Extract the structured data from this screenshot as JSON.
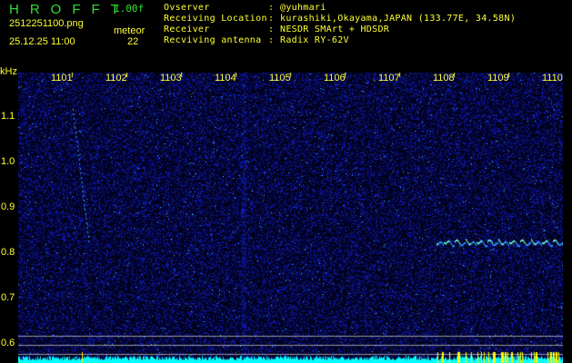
{
  "header": {
    "app_name": "HROFFT",
    "version": "1.00f",
    "filename": "2512251100.png",
    "datetime": "25.12.25 11:00",
    "meteor_label": "meteor",
    "meteor_count": "22"
  },
  "info": [
    {
      "label": "Ovserver",
      "value": "@yuhmari"
    },
    {
      "label": "Receiving Location",
      "value": "kurashiki,Okayama,JAPAN (133.77E, 34.58N)"
    },
    {
      "label": "Receiver",
      "value": "NESDR SMArt + HDSDR"
    },
    {
      "label": "Recviving antenna",
      "value": "Radix RY-62V"
    }
  ],
  "axes": {
    "y_unit": "kHz",
    "x_ticks": [
      "1101",
      "1102",
      "1103",
      "1104",
      "1105",
      "1106",
      "1107",
      "1108",
      "1109",
      "1110"
    ],
    "y_ticks": [
      "1.1",
      "1.0",
      "0.9",
      "0.8",
      "0.7",
      "0.6"
    ]
  },
  "colors": {
    "label": "#ffff33",
    "logo": "#33dd33",
    "noise": "#1a2ad0",
    "baseline": "#00ffff"
  }
}
